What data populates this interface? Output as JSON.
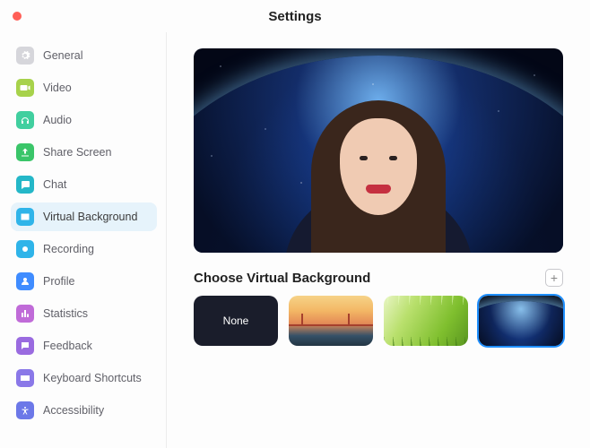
{
  "window": {
    "title": "Settings"
  },
  "sidebar": {
    "items": [
      {
        "label": "General",
        "icon": "gear-icon",
        "color": "#d6d6db"
      },
      {
        "label": "Video",
        "icon": "video-icon",
        "color": "#a7d24b"
      },
      {
        "label": "Audio",
        "icon": "headphones-icon",
        "color": "#41cf9f"
      },
      {
        "label": "Share Screen",
        "icon": "share-icon",
        "color": "#3ac569"
      },
      {
        "label": "Chat",
        "icon": "chat-icon",
        "color": "#24b7c8"
      },
      {
        "label": "Virtual Background",
        "icon": "background-icon",
        "color": "#2fb4e9",
        "active": true
      },
      {
        "label": "Recording",
        "icon": "record-icon",
        "color": "#2fb4e9"
      },
      {
        "label": "Profile",
        "icon": "profile-icon",
        "color": "#3f8cff"
      },
      {
        "label": "Statistics",
        "icon": "stats-icon",
        "color": "#c06bd8"
      },
      {
        "label": "Feedback",
        "icon": "feedback-icon",
        "color": "#9a6be0"
      },
      {
        "label": "Keyboard Shortcuts",
        "icon": "keyboard-icon",
        "color": "#8a78e8"
      },
      {
        "label": "Accessibility",
        "icon": "accessibility-icon",
        "color": "#6c78e8"
      }
    ]
  },
  "main": {
    "section_title": "Choose Virtual Background",
    "add_label": "+",
    "thumbs": {
      "none_label": "None",
      "options": [
        {
          "name": "none",
          "selected": false
        },
        {
          "name": "bridge",
          "selected": false
        },
        {
          "name": "grass",
          "selected": false
        },
        {
          "name": "earth",
          "selected": true
        }
      ]
    }
  }
}
